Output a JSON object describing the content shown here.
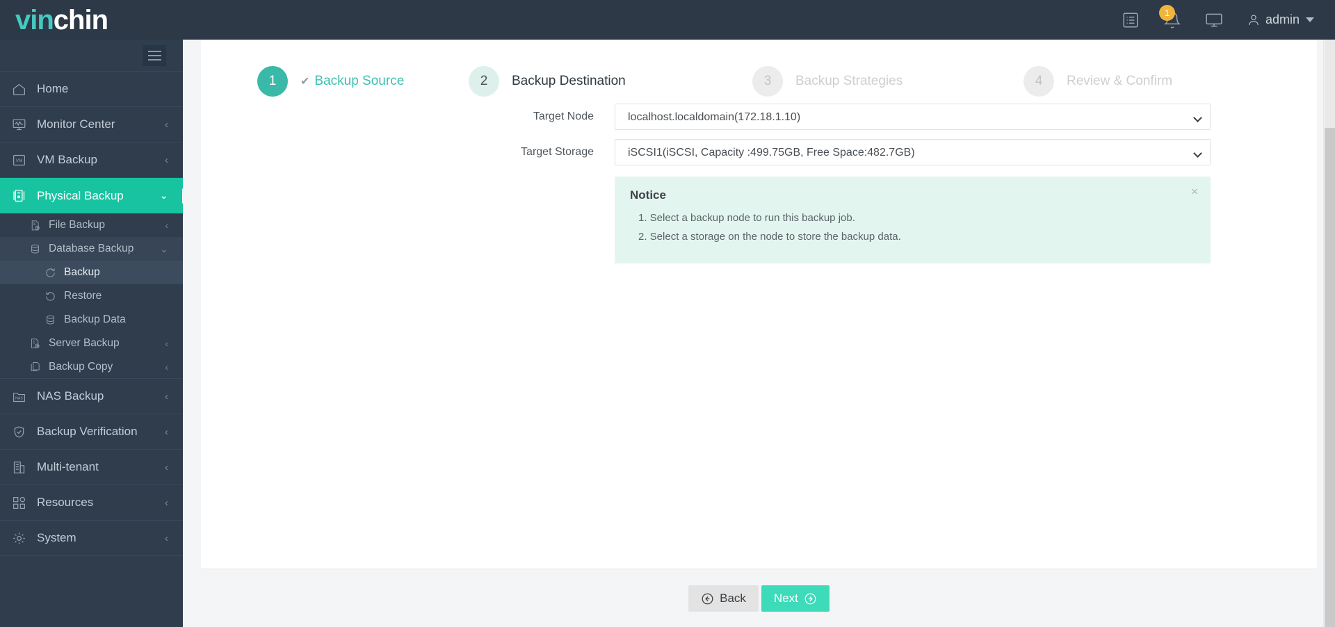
{
  "brand": {
    "part1": "vin",
    "part2": "chin"
  },
  "header": {
    "log_icon": "list-icon",
    "notification_icon": "bell-icon",
    "notification_count": "1",
    "console_icon": "monitor-icon",
    "user_icon": "user-icon",
    "user_name": "admin",
    "user_caret": "chevron-down-icon"
  },
  "sidebar": {
    "toggle": "hamburger-icon",
    "items": [
      {
        "label": "Home",
        "icon": "home-icon",
        "arrow": ""
      },
      {
        "label": "Monitor Center",
        "icon": "monitor-chart-icon",
        "arrow": "‹"
      },
      {
        "label": "VM Backup",
        "icon": "vm-icon",
        "arrow": "‹"
      },
      {
        "label": "Physical Backup",
        "icon": "server-icon",
        "arrow": "⌄",
        "active": true
      },
      {
        "label": "NAS Backup",
        "icon": "nas-folder-icon",
        "arrow": "‹"
      },
      {
        "label": "Backup Verification",
        "icon": "shield-check-icon",
        "arrow": "‹"
      },
      {
        "label": "Multi-tenant",
        "icon": "building-icon",
        "arrow": "‹"
      },
      {
        "label": "Resources",
        "icon": "grid-icon",
        "arrow": "‹"
      },
      {
        "label": "System",
        "icon": "gear-icon",
        "arrow": "‹"
      }
    ],
    "physical_backup_children": [
      {
        "label": "File Backup",
        "icon": "file-add-icon",
        "arrow": "‹"
      },
      {
        "label": "Database Backup",
        "icon": "database-icon",
        "arrow": "⌄",
        "expanded": true
      },
      {
        "label": "Backup",
        "icon": "refresh-cw-icon",
        "level": 2,
        "selected": true
      },
      {
        "label": "Restore",
        "icon": "refresh-ccw-icon",
        "level": 2
      },
      {
        "label": "Backup Data",
        "icon": "database-icon",
        "level": 2
      },
      {
        "label": "Server Backup",
        "icon": "server-add-icon",
        "arrow": "‹"
      },
      {
        "label": "Backup Copy",
        "icon": "copy-icon",
        "arrow": "‹"
      }
    ]
  },
  "wizard": {
    "steps": [
      {
        "number": "1",
        "label": "Backup Source",
        "state": "done",
        "check": "✔"
      },
      {
        "number": "2",
        "label": "Backup Destination",
        "state": "current",
        "check": ""
      },
      {
        "number": "3",
        "label": "Backup Strategies",
        "state": "todo",
        "check": ""
      },
      {
        "number": "4",
        "label": "Review & Confirm",
        "state": "todo",
        "check": ""
      }
    ]
  },
  "form": {
    "target_node_label": "Target Node",
    "target_node_value": "localhost.localdomain(172.18.1.10)",
    "target_storage_label": "Target Storage",
    "target_storage_value": "iSCSI1(iSCSI, Capacity :499.75GB, Free Space:482.7GB)"
  },
  "notice": {
    "title": "Notice",
    "close_label": "×",
    "items": [
      "1. Select a backup node to run this backup job.",
      "2. Select a storage on the node to store the backup data."
    ]
  },
  "footer": {
    "back_label": "Back",
    "back_icon": "arrow-left-circle-icon",
    "next_label": "Next",
    "next_icon": "arrow-right-circle-icon"
  },
  "colors": {
    "brand_teal": "#45c9c2",
    "accent_teal": "#3ddbba",
    "sidebar_active": "#18c3a1",
    "sidebar_bg": "#2f3d4d",
    "topbar_bg": "#2d3946",
    "notice_bg": "#e3f5ef",
    "badge_orange": "#efb53c"
  }
}
